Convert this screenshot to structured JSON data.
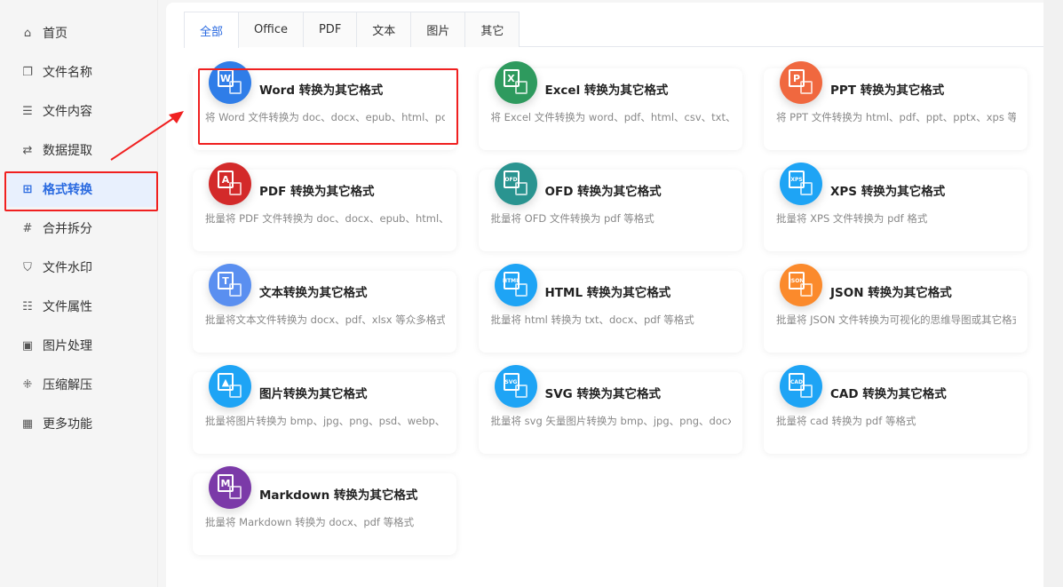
{
  "sidebar": {
    "items": [
      {
        "label": "首页",
        "icon": "⌂",
        "name": "home"
      },
      {
        "label": "文件名称",
        "icon": "❐",
        "name": "file-name"
      },
      {
        "label": "文件内容",
        "icon": "☰",
        "name": "file-content"
      },
      {
        "label": "数据提取",
        "icon": "⇄",
        "name": "data-extract"
      },
      {
        "label": "格式转换",
        "icon": "⊞",
        "name": "format-convert",
        "active": true
      },
      {
        "label": "合并拆分",
        "icon": "#",
        "name": "merge-split"
      },
      {
        "label": "文件水印",
        "icon": "⛉",
        "name": "watermark"
      },
      {
        "label": "文件属性",
        "icon": "☷",
        "name": "file-properties"
      },
      {
        "label": "图片处理",
        "icon": "▣",
        "name": "image-process"
      },
      {
        "label": "压缩解压",
        "icon": "⁜",
        "name": "compress"
      },
      {
        "label": "更多功能",
        "icon": "▦",
        "name": "more"
      }
    ]
  },
  "tabs": [
    "全部",
    "Office",
    "PDF",
    "文本",
    "图片",
    "其它"
  ],
  "cards": [
    {
      "title": "Word 转换为其它格式",
      "desc": "将 Word 文件转换为 doc、docx、epub、html、pdf",
      "glyph": "W",
      "color": "#2f7de8"
    },
    {
      "title": "Excel 转换为其它格式",
      "desc": "将 Excel 文件转换为 word、pdf、html、csv、txt、svg",
      "glyph": "X",
      "color": "#2e9a5e"
    },
    {
      "title": "PPT 转换为其它格式",
      "desc": "将 PPT 文件转换为 html、pdf、ppt、pptx、xps 等",
      "glyph": "P",
      "color": "#f0683f"
    },
    {
      "title": "PDF 转换为其它格式",
      "desc": "批量将 PDF 文件转换为 doc、docx、epub、html、",
      "glyph": "A",
      "color": "#d32a2a"
    },
    {
      "title": "OFD 转换为其它格式",
      "desc": "批量将 OFD 文件转换为 pdf 等格式",
      "glyph": "OFD",
      "color": "#2a9490"
    },
    {
      "title": "XPS 转换为其它格式",
      "desc": "批量将 XPS 文件转换为 pdf 格式",
      "glyph": "XPS",
      "color": "#1ea4f5"
    },
    {
      "title": "文本转换为其它格式",
      "desc": "批量将文本文件转换为 docx、pdf、xlsx 等众多格式",
      "glyph": "T",
      "color": "#5a8ff0"
    },
    {
      "title": "HTML 转换为其它格式",
      "desc": "批量将 html 转换为 txt、docx、pdf 等格式",
      "glyph": "HTML",
      "color": "#1ea4f5"
    },
    {
      "title": "JSON 转换为其它格式",
      "desc": "批量将 JSON 文件转换为可视化的思维导图或其它格式",
      "glyph": "JSON",
      "color": "#fb8a2c"
    },
    {
      "title": "图片转换为其它格式",
      "desc": "批量将图片转换为 bmp、jpg、png、psd、webp、",
      "glyph": "▲",
      "color": "#1ea4f5"
    },
    {
      "title": "SVG 转换为其它格式",
      "desc": "批量将 svg 矢量图片转换为 bmp、jpg、png、docx",
      "glyph": "SVG",
      "color": "#1ea4f5"
    },
    {
      "title": "CAD 转换为其它格式",
      "desc": "批量将 cad 转换为 pdf 等格式",
      "glyph": "CAD",
      "color": "#1ea4f5"
    },
    {
      "title": "Markdown 转换为其它格式",
      "desc": "批量将 Markdown 转换为 docx、pdf 等格式",
      "glyph": "M",
      "color": "#7b3aa8"
    }
  ]
}
